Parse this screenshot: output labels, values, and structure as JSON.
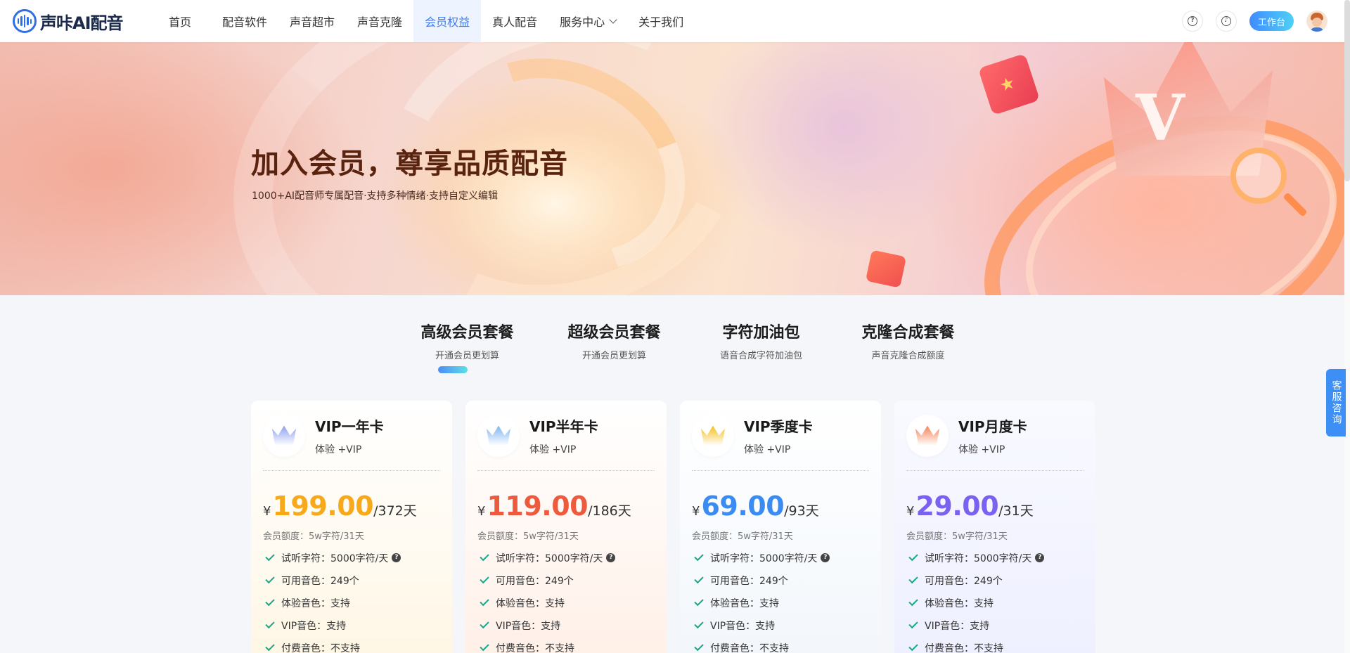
{
  "logo": {
    "text": "声咔AI配音"
  },
  "nav": {
    "items": [
      {
        "label": "首页",
        "active": false
      },
      {
        "label": "配音软件",
        "active": false
      },
      {
        "label": "声音超市",
        "active": false
      },
      {
        "label": "声音克隆",
        "active": false
      },
      {
        "label": "会员权益",
        "active": true
      },
      {
        "label": "真人配音",
        "active": false
      },
      {
        "label": "服务中心",
        "active": false,
        "dropdown": true
      },
      {
        "label": "关于我们",
        "active": false
      }
    ],
    "help_icon": "question-icon",
    "settings_icon": "tiktok-icon",
    "workbench_label": "工作台",
    "accent_color": "#3d7bf5"
  },
  "hero": {
    "title": "加入会员，尊享品质配音",
    "subtitle": "1000+AI配音师专属配音·支持多种情绪·支持自定义编辑"
  },
  "tabs": [
    {
      "title": "高级会员套餐",
      "sub": "开通会员更划算",
      "selected": true
    },
    {
      "title": "超级会员套餐",
      "sub": "开通会员更划算",
      "selected": false
    },
    {
      "title": "字符加油包",
      "sub": "语音合成字符加油包",
      "selected": false
    },
    {
      "title": "克隆合成套餐",
      "sub": "声音克隆合成额度",
      "selected": false
    }
  ],
  "plans": [
    {
      "name": "VIP一年卡",
      "desc": "体验 +VIP",
      "currency": "¥",
      "price": "199.00",
      "period": "/372天",
      "price_color": "#f7a81b",
      "quota": "会员额度：5w字符/31天",
      "features": [
        "试听字符：5000字符/天",
        "可用音色：249个",
        "体验音色：支持",
        "VIP音色：支持",
        "付费音色：不支持"
      ]
    },
    {
      "name": "VIP半年卡",
      "desc": "体验 +VIP",
      "currency": "¥",
      "price": "119.00",
      "period": "/186天",
      "price_color": "#ee5a3d",
      "quota": "会员额度：5w字符/31天",
      "features": [
        "试听字符：5000字符/天",
        "可用音色：249个",
        "体验音色：支持",
        "VIP音色：支持",
        "付费音色：不支持"
      ]
    },
    {
      "name": "VIP季度卡",
      "desc": "体验 +VIP",
      "currency": "¥",
      "price": "69.00",
      "period": "/93天",
      "price_color": "#3b8cf2",
      "quota": "会员额度：5w字符/31天",
      "features": [
        "试听字符：5000字符/天",
        "可用音色：249个",
        "体验音色：支持",
        "VIP音色：支持",
        "付费音色：不支持"
      ]
    },
    {
      "name": "VIP月度卡",
      "desc": "体验 +VIP",
      "currency": "¥",
      "price": "29.00",
      "period": "/31天",
      "price_color": "#7b61f0",
      "quota": "会员额度：5w字符/31天",
      "features": [
        "试听字符：5000字符/天",
        "可用音色：249个",
        "体验音色：支持",
        "VIP音色：支持",
        "付费音色：不支持"
      ]
    }
  ],
  "crown_colors": [
    "#8fa0f0",
    "#7fb6f2",
    "#f5c020",
    "#f5845a"
  ],
  "service": {
    "label": "客服咨询"
  }
}
